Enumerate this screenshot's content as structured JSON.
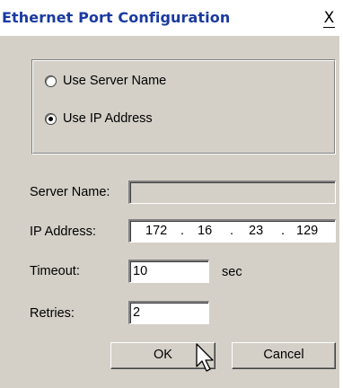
{
  "window": {
    "title": "Ethernet Port Configuration",
    "close_glyph": "X"
  },
  "address_mode": {
    "options": [
      {
        "label": "Use Server Name",
        "selected": false
      },
      {
        "label": "Use IP Address",
        "selected": true
      }
    ]
  },
  "form": {
    "server_name_label": "Server Name:",
    "server_name_value": "",
    "ip_label": "IP Address:",
    "ip_octets": [
      "172",
      "16",
      "23",
      "129"
    ],
    "ip_separator": ".",
    "timeout_label": "Timeout:",
    "timeout_value": "10",
    "timeout_unit": "sec",
    "retries_label": "Retries:",
    "retries_value": "2"
  },
  "buttons": {
    "ok_label": "OK",
    "cancel_label": "Cancel"
  },
  "colors": {
    "title_text": "#1a3aa0",
    "dialog_face": "#d4d0c8"
  },
  "icons": {
    "close": "close-icon",
    "cursor": "mouse-pointer-icon"
  }
}
